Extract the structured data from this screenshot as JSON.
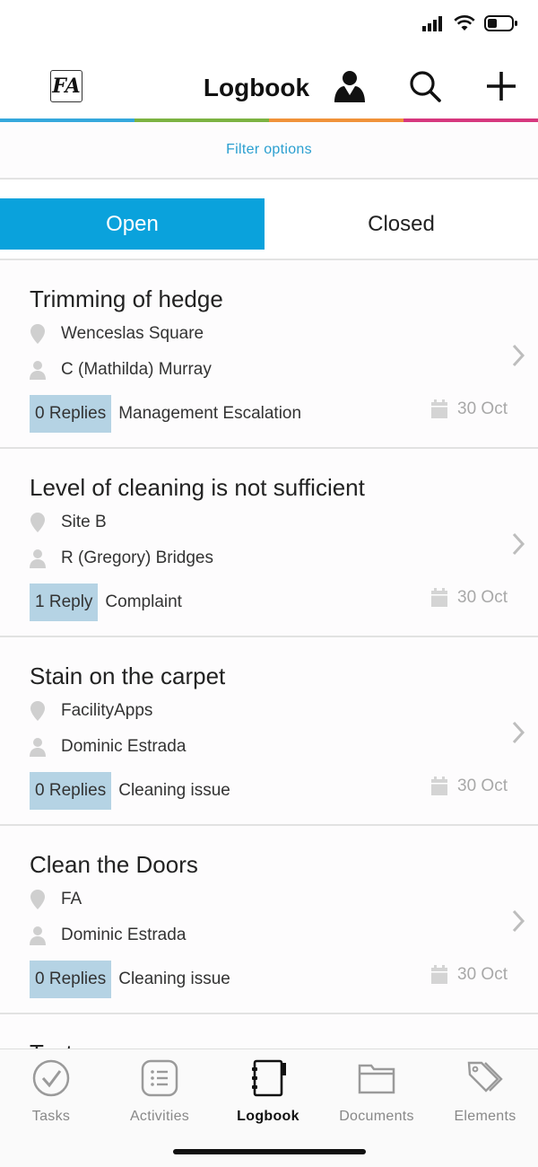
{
  "header": {
    "logo_text": "FA",
    "title": "Logbook"
  },
  "accent_colors": [
    "#35a8dc",
    "#7cb342",
    "#f0923a",
    "#d6377e"
  ],
  "filter": {
    "label": "Filter options"
  },
  "segments": {
    "open": "Open",
    "closed": "Closed"
  },
  "items": [
    {
      "title": "Trimming of hedge",
      "location": "Wenceslas Square",
      "person": "C (Mathilda) Murray",
      "replies": "0 Replies",
      "category": "Management Escalation",
      "date": "30 Oct"
    },
    {
      "title": "Level of cleaning is not sufficient",
      "location": "Site B",
      "person": "R (Gregory) Bridges",
      "replies": "1 Reply",
      "category": "Complaint",
      "date": "30 Oct"
    },
    {
      "title": "Stain on the carpet",
      "location": "FacilityApps",
      "person": "Dominic Estrada",
      "replies": "0 Replies",
      "category": "Cleaning issue",
      "date": "30 Oct"
    },
    {
      "title": "Clean the Doors",
      "location": "FA",
      "person": "Dominic Estrada",
      "replies": "0 Replies",
      "category": "Cleaning issue",
      "date": "30 Oct"
    },
    {
      "title": "Test"
    }
  ],
  "tabs": [
    {
      "label": "Tasks",
      "icon": "check-circle-icon"
    },
    {
      "label": "Activities",
      "icon": "list-icon"
    },
    {
      "label": "Logbook",
      "icon": "notebook-icon",
      "active": true
    },
    {
      "label": "Documents",
      "icon": "folder-icon"
    },
    {
      "label": "Elements",
      "icon": "tags-icon"
    }
  ]
}
